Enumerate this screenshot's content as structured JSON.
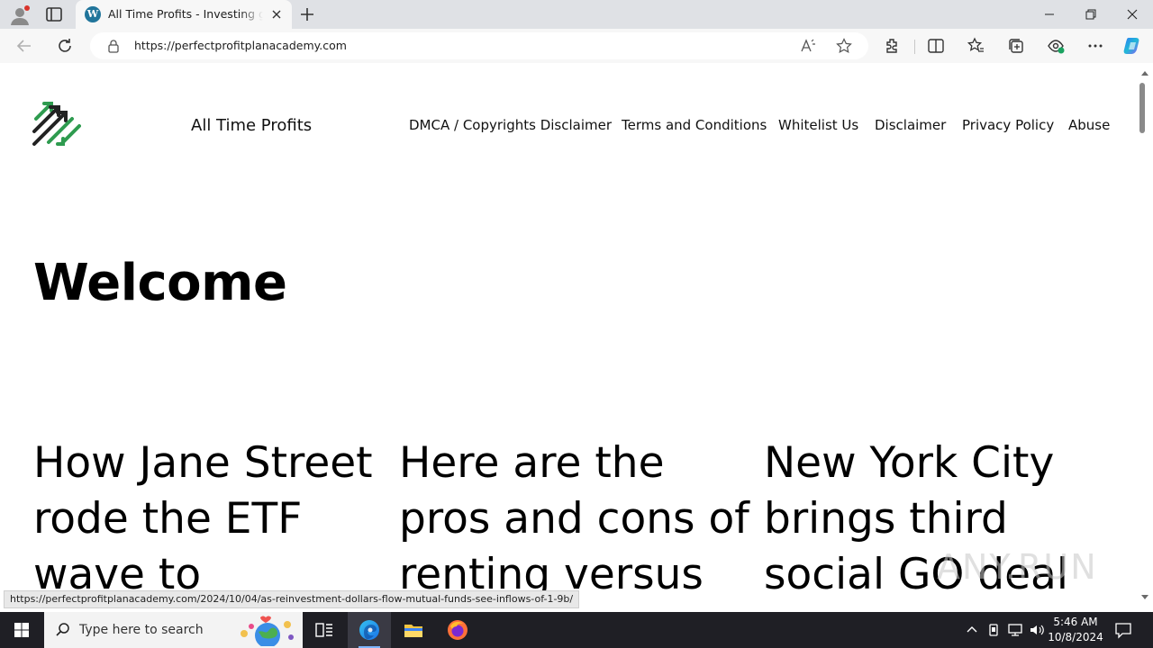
{
  "browser": {
    "tab_title": "All Time Profits - Investing guide",
    "url": "https://perfectprofitplanacademy.com",
    "status_url": "https://perfectprofitplanacademy.com/2024/10/04/as-reinvestment-dollars-flow-mutual-funds-see-inflows-of-1-9b/"
  },
  "site": {
    "name": "All Time Profits",
    "nav": [
      "DMCA / Copyrights Disclaimer",
      "Terms and Conditions",
      "Whitelist Us",
      "Disclaimer",
      "Privacy Policy",
      "Abuse"
    ],
    "heading": "Welcome",
    "posts": [
      {
        "title_lines": [
          "How Jane Street",
          "rode the ETF",
          "wave to"
        ]
      },
      {
        "title_lines": [
          "Here are the",
          "pros and cons of",
          "renting versus"
        ]
      },
      {
        "title_lines": [
          "New York City",
          "brings third",
          "social GO deal"
        ]
      }
    ],
    "logo_colors": {
      "green": "#2e9b4f",
      "dark": "#222222"
    }
  },
  "watermark": "ANY.RUN",
  "taskbar": {
    "search_placeholder": "Type here to search",
    "time": "5:46 AM",
    "date": "10/8/2024"
  }
}
